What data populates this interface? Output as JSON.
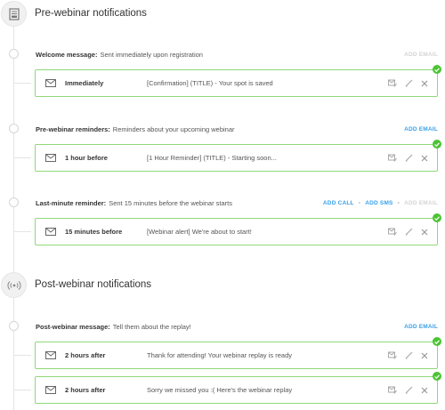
{
  "sections": {
    "pre": {
      "title": "Pre-webinar notifications",
      "icon": "document-icon"
    },
    "post": {
      "title": "Post-webinar notifications",
      "icon": "broadcast-icon"
    }
  },
  "rows": {
    "welcome": {
      "label": "Welcome message:",
      "description": "Sent immediately upon registration",
      "add_email": "ADD EMAIL",
      "card": {
        "timing": "Immediately",
        "subject": "[Confirmation] (TITLE) - Your spot is saved"
      }
    },
    "reminders": {
      "label": "Pre-webinar reminders:",
      "description": "Reminders about your upcoming webinar",
      "add_email": "ADD EMAIL",
      "card": {
        "timing": "1 hour before",
        "subject": "[1 Hour Reminder] (TITLE) - Starting soon..."
      }
    },
    "last_minute": {
      "label": "Last-minute reminder:",
      "description": "Sent 15 minutes before the webinar starts",
      "add_call": "ADD CALL",
      "add_sms": "ADD SMS",
      "add_email": "ADD EMAIL",
      "card": {
        "timing": "15 minutes before",
        "subject": "[Webinar alert] We're about to start!"
      }
    },
    "post_message": {
      "label": "Post-webinar message:",
      "description": "Tell them about the replay!",
      "add_email": "ADD EMAIL",
      "cards": [
        {
          "timing": "2 hours after",
          "subject": "Thank for attending! Your webinar replay is ready"
        },
        {
          "timing": "2 hours after",
          "subject": "Sorry we missed you :( Here's the webinar replay"
        }
      ]
    }
  },
  "colors": {
    "accent": "#3aa0e8",
    "card_border": "#90d87a",
    "check": "#4bc434",
    "disabled": "#d4d4d4"
  }
}
